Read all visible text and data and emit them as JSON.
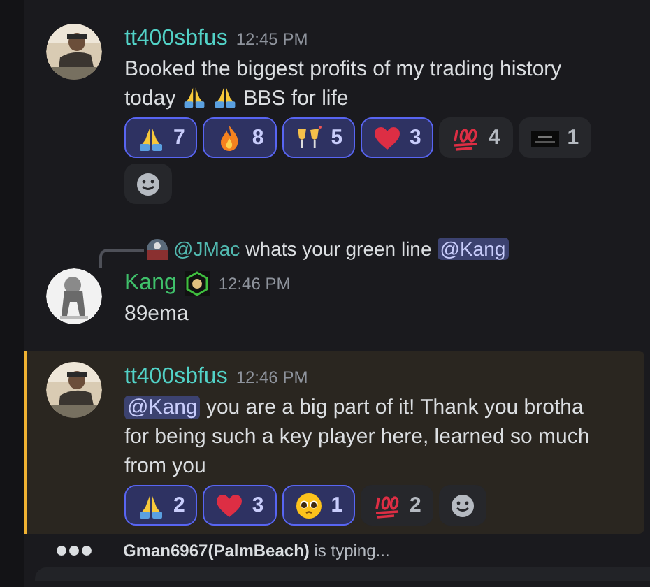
{
  "messages": [
    {
      "author": "tt400sbfus",
      "color": "#52d1c6",
      "time": "12:45 PM",
      "highlighted": false,
      "avatar": {
        "kind": "picture"
      },
      "content": [
        {
          "kind": "text",
          "text": "Booked the biggest profits of my trading history today"
        },
        {
          "kind": "pray"
        },
        {
          "kind": "pray"
        },
        {
          "kind": "text",
          "text": "BBS for life"
        }
      ],
      "reactions": [
        {
          "kind": "pray",
          "count": "7",
          "selected": true
        },
        {
          "kind": "fire",
          "count": "8",
          "selected": true
        },
        {
          "kind": "cheers",
          "count": "5",
          "selected": true
        },
        {
          "kind": "heart",
          "count": "3",
          "selected": true
        },
        {
          "kind": "hundred",
          "count": "4",
          "selected": false
        },
        {
          "kind": "custom",
          "count": "1",
          "selected": false
        }
      ]
    },
    {
      "author": "Kang",
      "color": "#3fbf6a",
      "time": "12:46 PM",
      "highlighted": false,
      "avatar": {
        "kind": "picture"
      },
      "badge": true,
      "reply": {
        "author": "@JMac",
        "text": "whats your green line",
        "mention": "@Kang"
      },
      "content": [
        {
          "kind": "text",
          "text": "89ema"
        }
      ]
    },
    {
      "author": "tt400sbfus",
      "color": "#52d1c6",
      "time": "12:46 PM",
      "highlighted": true,
      "avatar": {
        "kind": "picture"
      },
      "content": [
        {
          "kind": "mention",
          "text": "@Kang"
        },
        {
          "kind": "text",
          "text": "you are a big part of it! Thank you brotha for being such a key player here, learned so much from you"
        }
      ],
      "reactions": [
        {
          "kind": "pray",
          "count": "2",
          "selected": true
        },
        {
          "kind": "heart",
          "count": "3",
          "selected": true
        },
        {
          "kind": "pleading",
          "count": "1",
          "selected": true
        },
        {
          "kind": "hundred",
          "count": "2",
          "selected": false
        }
      ]
    }
  ],
  "typing": {
    "user": "Gman6967(PalmBeach)",
    "text": "is typing..."
  }
}
